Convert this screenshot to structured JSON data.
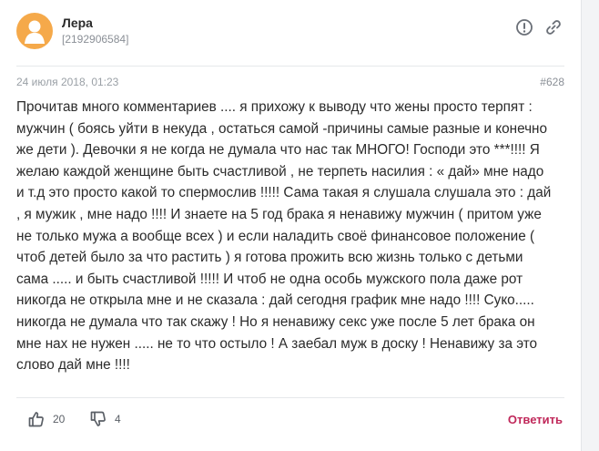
{
  "comment": {
    "author_name": "Лера",
    "author_id": "[2192906584]",
    "date": "24 июля 2018, 01:23",
    "number": "#628",
    "text": "Прочитав много комментариев .... я прихожу к выводу что жены просто терпят : мужчин ( боясь уйти в некуда , остаться самой -причины самые разные и конечно же дети ). Девочки я не когда не думала что нас так МНОГО! Господи это ***!!!! Я желаю каждой женщине быть счастливой , не терпеть насилия : « дай» мне надо и т.д это просто какой то спермослив !!!!! Сама такая я слушала слушала это : дай , я мужик , мне надо !!!! И знаете на 5 год брака я ненавижу мужчин ( притом уже не только мужа а вообще всех ) и если наладить своё финансовое положение ( чтоб детей было за что растить ) я готова прожить всю жизнь только с детьми сама ..... и быть счастливой !!!!! И чтоб не одна особь мужского пола даже рот никогда не открыла мне и не сказала : дай сегодня график мне надо !!!! Суко..... никогда не думала что так скажу ! Но я ненавижу секс уже после 5 лет брака он мне нах не нужен ..... не то что остыло ! А заебал муж в доску ! Ненавижу за это слово дай мне !!!!",
    "likes": "20",
    "dislikes": "4",
    "reply_label": "Ответить"
  },
  "icons": {
    "avatar": "user-silhouette-icon",
    "report": "exclamation-circle-icon",
    "link": "link-icon",
    "like": "thumbs-up-icon",
    "dislike": "thumbs-down-icon"
  },
  "colors": {
    "avatar_bg": "#f5a94a",
    "reply": "#c0285a"
  }
}
